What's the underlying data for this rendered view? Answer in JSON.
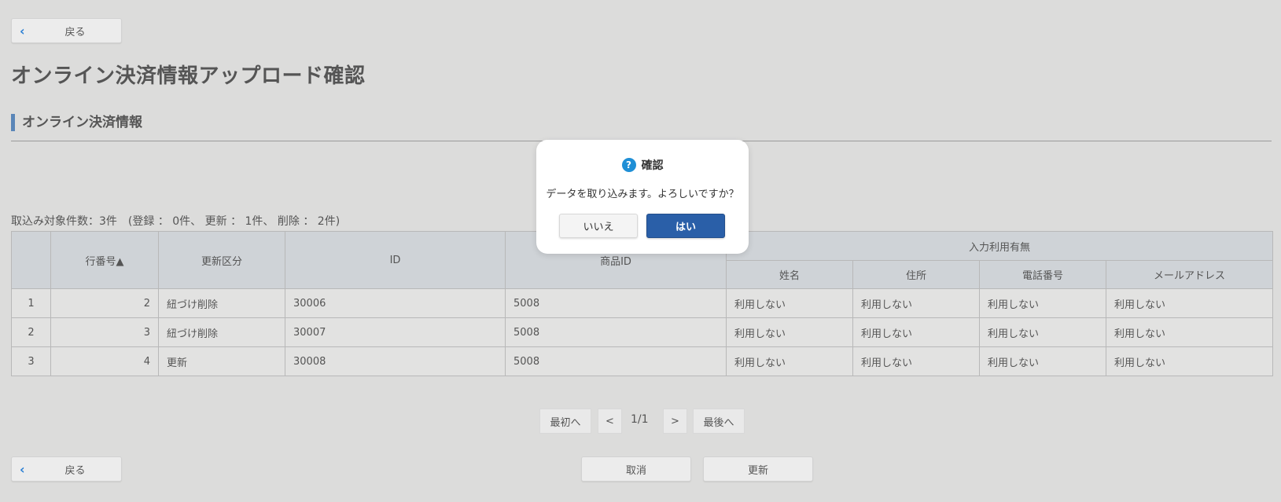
{
  "back_label": "戻る",
  "page_title": "オンライン決済情報アップロード確認",
  "section_title": "オンライン決済情報",
  "summary": "取込み対象件数：3件　(登録 ： 0件、 更新 ： 1件、 削除 ： 2件)",
  "table": {
    "headers": {
      "no": "",
      "line": "行番号▲",
      "kind": "更新区分",
      "id": "ID",
      "product_id": "商品ID",
      "input_group": "入力利用有無",
      "name": "姓名",
      "address": "住所",
      "phone": "電話番号",
      "email": "メールアドレス"
    },
    "rows": [
      {
        "no": "1",
        "line": "2",
        "kind": "紐づけ削除",
        "id": "30006",
        "product_id": "5008",
        "name": "利用しない",
        "address": "利用しない",
        "phone": "利用しない",
        "email": "利用しない"
      },
      {
        "no": "2",
        "line": "3",
        "kind": "紐づけ削除",
        "id": "30007",
        "product_id": "5008",
        "name": "利用しない",
        "address": "利用しない",
        "phone": "利用しない",
        "email": "利用しない"
      },
      {
        "no": "3",
        "line": "4",
        "kind": "更新",
        "id": "30008",
        "product_id": "5008",
        "name": "利用しない",
        "address": "利用しない",
        "phone": "利用しない",
        "email": "利用しない"
      }
    ]
  },
  "pager": {
    "first": "最初へ",
    "prev": "<",
    "page": "1/1",
    "next": ">",
    "last": "最後へ"
  },
  "actions": {
    "cancel": "取消",
    "update": "更新"
  },
  "dialog": {
    "title": "確認",
    "icon": "question-icon",
    "message": "データを取り込みます。よろしいですか？",
    "no": "いいえ",
    "yes": "はい",
    "yes_color": "#2a5fa8"
  }
}
